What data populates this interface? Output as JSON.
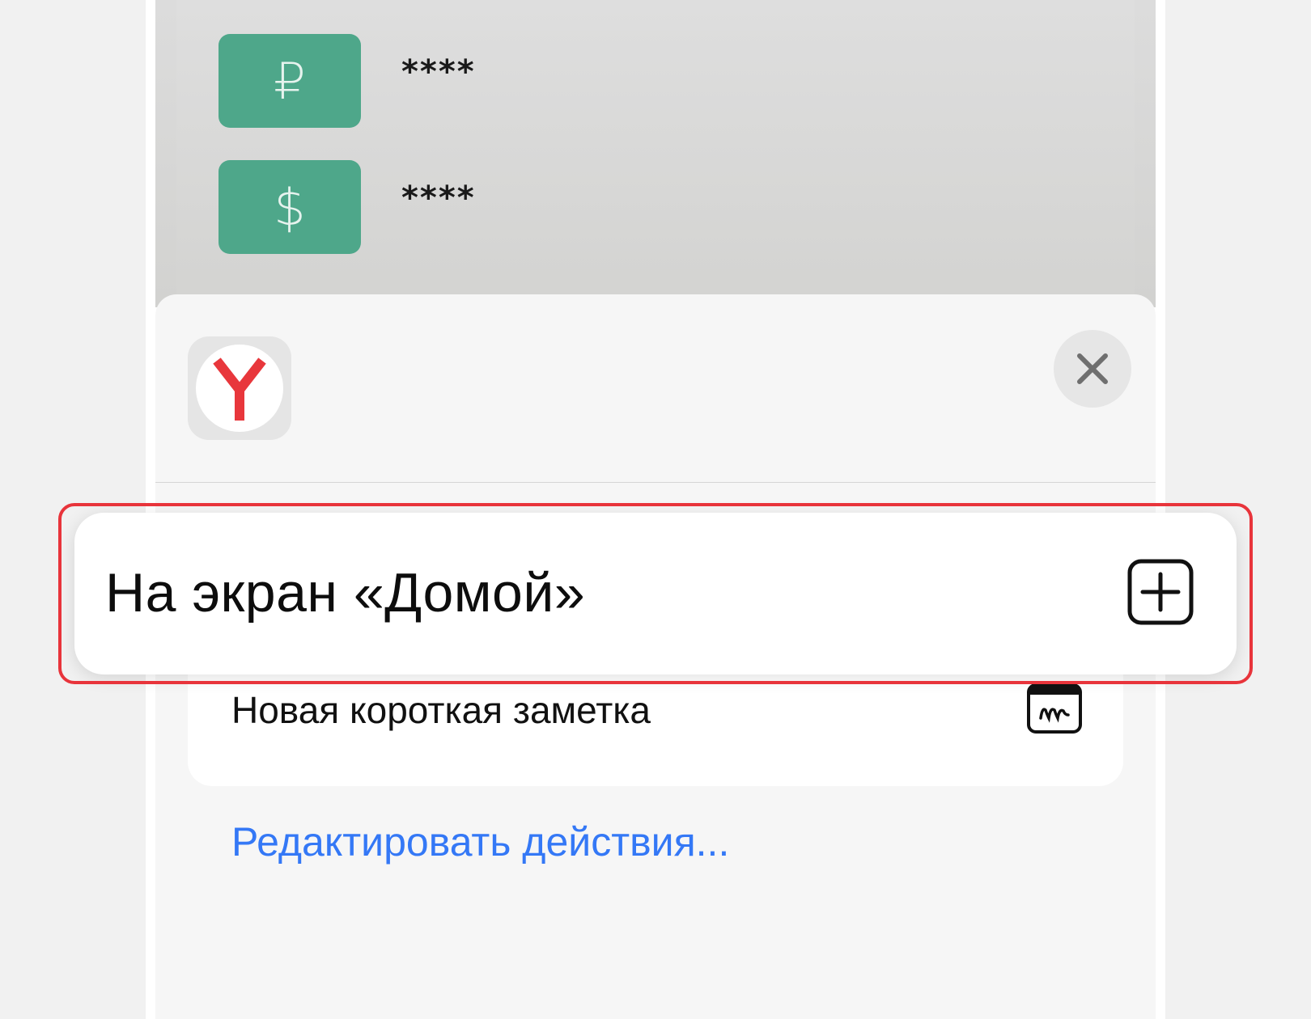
{
  "background": {
    "accounts": [
      {
        "currency_symbol": "₽",
        "masked_balance": "****",
        "icon": "ruble-icon"
      },
      {
        "currency_symbol": "$",
        "masked_balance": "****",
        "icon": "dollar-icon"
      }
    ],
    "tile_color": "#4ea78a"
  },
  "sheet": {
    "app_icon": "yandex-browser-icon",
    "close_icon": "close-icon",
    "actions": [
      {
        "label": "На экран «Домой»",
        "icon": "add-square-icon",
        "highlighted": true
      },
      {
        "label": "Новая короткая заметка",
        "icon": "quick-note-icon",
        "highlighted": false
      }
    ],
    "edit_actions_label": "Редактировать действия..."
  },
  "colors": {
    "highlight_border": "#e8343b",
    "link": "#3478f6",
    "yandex_red": "#e8373c"
  }
}
